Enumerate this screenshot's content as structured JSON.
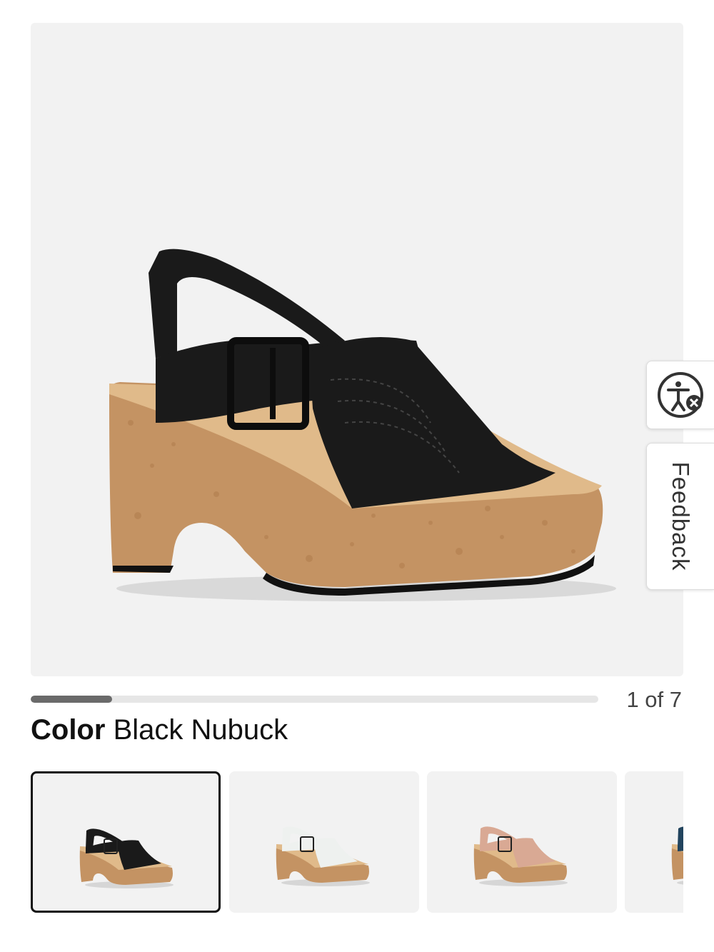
{
  "gallery": {
    "current": 1,
    "total": 7,
    "counter_text": "1 of 7",
    "progress_fraction": 0.143
  },
  "color": {
    "label": "Color",
    "value": "Black Nubuck"
  },
  "swatches": [
    {
      "name": "black",
      "strap_color": "#1a1a1a",
      "selected": true
    },
    {
      "name": "white",
      "strap_color": "#eef1ef",
      "selected": false
    },
    {
      "name": "blush",
      "strap_color": "#d9a994",
      "selected": false
    },
    {
      "name": "navy",
      "strap_color": "#22445e",
      "selected": false
    }
  ],
  "side_widgets": {
    "accessibility_icon": "accessibility-icon",
    "feedback_label": "Feedback"
  },
  "colors": {
    "cork": "#c49363",
    "footbed": "#e0ba8a",
    "strap": "#1a1a1a",
    "background": "#f2f2f2"
  }
}
